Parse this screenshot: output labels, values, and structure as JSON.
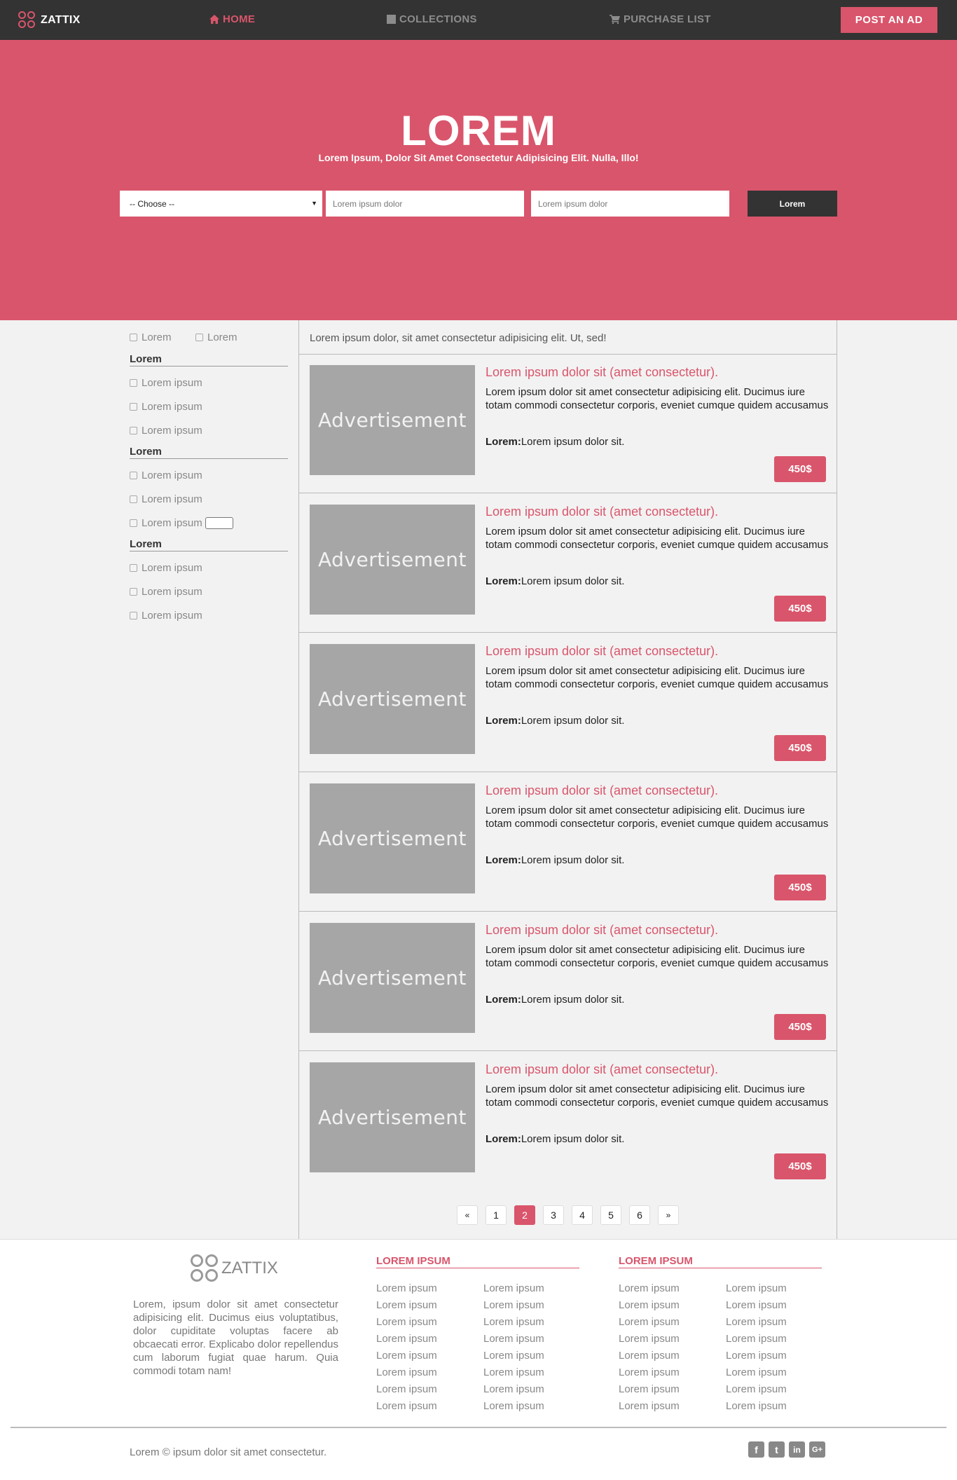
{
  "nav": {
    "brand": "ZATTIX",
    "items": [
      {
        "label": "HOME",
        "icon": "home-icon",
        "active": true
      },
      {
        "label": "COLLECTIONS",
        "icon": "square-icon",
        "active": false
      },
      {
        "label": "PURCHASE LIST",
        "icon": "cart-icon",
        "active": false
      }
    ],
    "cta": "POST AN AD"
  },
  "hero": {
    "title": "LOREM",
    "subtitle": "Lorem Ipsum, Dolor Sit Amet Consectetur Adipisicing Elit. Nulla, Illo!",
    "select_value": "-- Choose --",
    "input1_placeholder": "Lorem ipsum dolor",
    "input2_placeholder": "Lorem ipsum dolor",
    "button": "Lorem"
  },
  "sidebar": {
    "top_checks": [
      "Lorem",
      "Lorem"
    ],
    "groups": [
      {
        "heading": "Lorem",
        "items": [
          "Lorem ipsum",
          "Lorem ipsum",
          "Lorem ipsum"
        ]
      },
      {
        "heading": "Lorem",
        "items": [
          "Lorem ipsum",
          "Lorem ipsum",
          "Lorem ipsum"
        ]
      },
      {
        "heading": "Lorem",
        "items": [
          "Lorem ipsum",
          "Lorem ipsum",
          "Lorem ipsum"
        ]
      }
    ]
  },
  "listing": {
    "intro": "Lorem ipsum dolor, sit amet consectetur adipisicing elit. Ut, sed!",
    "ads": [
      {
        "image_label": "Advertisement",
        "title": "Lorem ipsum dolor sit (amet consectetur).",
        "description": "Lorem ipsum dolor sit amet consectetur adipisicing elit. Ducimus iure totam commodi consectetur corporis, eveniet cumque quidem accusamus",
        "meta_label": "Lorem:",
        "meta_value": "Lorem ipsum dolor sit.",
        "price": "450$"
      },
      {
        "image_label": "Advertisement",
        "title": "Lorem ipsum dolor sit (amet consectetur).",
        "description": "Lorem ipsum dolor sit amet consectetur adipisicing elit. Ducimus iure totam commodi consectetur corporis, eveniet cumque quidem accusamus",
        "meta_label": "Lorem:",
        "meta_value": "Lorem ipsum dolor sit.",
        "price": "450$"
      },
      {
        "image_label": "Advertisement",
        "title": "Lorem ipsum dolor sit (amet consectetur).",
        "description": "Lorem ipsum dolor sit amet consectetur adipisicing elit. Ducimus iure totam commodi consectetur corporis, eveniet cumque quidem accusamus",
        "meta_label": "Lorem:",
        "meta_value": "Lorem ipsum dolor sit.",
        "price": "450$"
      },
      {
        "image_label": "Advertisement",
        "title": "Lorem ipsum dolor sit (amet consectetur).",
        "description": "Lorem ipsum dolor sit amet consectetur adipisicing elit. Ducimus iure totam commodi consectetur corporis, eveniet cumque quidem accusamus",
        "meta_label": "Lorem:",
        "meta_value": "Lorem ipsum dolor sit.",
        "price": "450$"
      },
      {
        "image_label": "Advertisement",
        "title": "Lorem ipsum dolor sit (amet consectetur).",
        "description": "Lorem ipsum dolor sit amet consectetur adipisicing elit. Ducimus iure totam commodi consectetur corporis, eveniet cumque quidem accusamus",
        "meta_label": "Lorem:",
        "meta_value": "Lorem ipsum dolor sit.",
        "price": "450$"
      },
      {
        "image_label": "Advertisement",
        "title": "Lorem ipsum dolor sit (amet consectetur).",
        "description": "Lorem ipsum dolor sit amet consectetur adipisicing elit. Ducimus iure totam commodi consectetur corporis, eveniet cumque quidem accusamus",
        "meta_label": "Lorem:",
        "meta_value": "Lorem ipsum dolor sit.",
        "price": "450$"
      }
    ]
  },
  "pagination": {
    "prev": "«",
    "pages": [
      "1",
      "2",
      "3",
      "4",
      "5",
      "6"
    ],
    "current": "2",
    "next": "»"
  },
  "footer": {
    "brand": "ZATTIX",
    "about": "Lorem, ipsum dolor sit amet consectetur adipisicing elit. Ducimus eius voluptatibus, dolor cupiditate voluptas facere ab obcaecati error. Explicabo dolor repellendus cum laborum fugiat quae harum. Quia commodi totam nam!",
    "col1_title": "LOREM IPSUM",
    "col2_title": "LOREM IPSUM",
    "col1_links_a": [
      "Lorem ipsum",
      "Lorem ipsum",
      "Lorem ipsum",
      "Lorem ipsum",
      "Lorem ipsum",
      "Lorem ipsum",
      "Lorem ipsum",
      "Lorem ipsum"
    ],
    "col1_links_b": [
      "Lorem ipsum",
      "Lorem ipsum",
      "Lorem ipsum",
      "Lorem ipsum",
      "Lorem ipsum",
      "Lorem ipsum",
      "Lorem ipsum",
      "Lorem ipsum"
    ],
    "col2_links_a": [
      "Lorem ipsum",
      "Lorem ipsum",
      "Lorem ipsum",
      "Lorem ipsum",
      "Lorem ipsum",
      "Lorem ipsum",
      "Lorem ipsum",
      "Lorem ipsum"
    ],
    "col2_links_b": [
      "Lorem ipsum",
      "Lorem ipsum",
      "Lorem ipsum",
      "Lorem ipsum",
      "Lorem ipsum",
      "Lorem ipsum",
      "Lorem ipsum",
      "Lorem ipsum"
    ],
    "copyright": "Lorem © ipsum dolor sit amet consectetur.",
    "social": [
      {
        "icon": "facebook-icon",
        "glyph": "f"
      },
      {
        "icon": "twitter-icon",
        "glyph": "t"
      },
      {
        "icon": "linkedin-icon",
        "glyph": "in"
      },
      {
        "icon": "google-plus-icon",
        "glyph": "G+"
      }
    ]
  },
  "colors": {
    "accent": "#d9556b",
    "nav_bg": "#333333",
    "page_bg": "#f2f2f2",
    "ad_placeholder": "#a6a6a6"
  }
}
